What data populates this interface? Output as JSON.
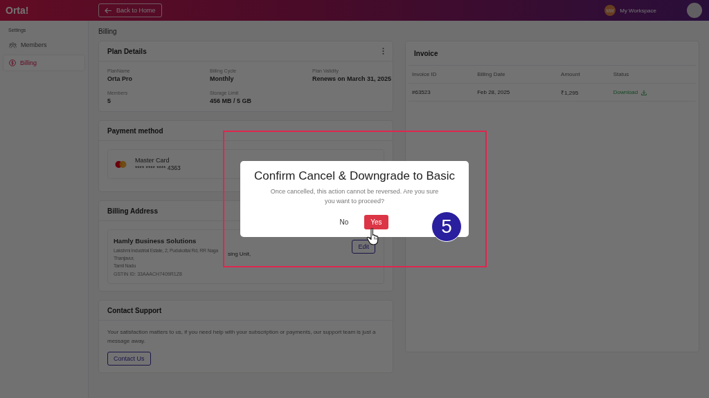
{
  "header": {
    "logo": "Orta!",
    "back_button": "Back to Home",
    "workspace": {
      "initials": "MW",
      "name": "My Workspace"
    }
  },
  "sidebar": {
    "section": "Settings",
    "items": [
      {
        "label": "Members",
        "selected": false
      },
      {
        "label": "Billing",
        "selected": true
      }
    ]
  },
  "page_title": "Billing",
  "plan_details": {
    "title": "Plan Details",
    "fields": [
      {
        "label": "PlanName",
        "value": "Orta Pro"
      },
      {
        "label": "Billing Cycle",
        "value": "Monthly"
      },
      {
        "label": "Plan Validity",
        "value": "Renews on March 31, 2025"
      },
      {
        "label": "Members",
        "value": "5"
      },
      {
        "label": "Storage Limit",
        "value": "456 MB / 5 GB"
      }
    ]
  },
  "payment_method": {
    "title": "Payment method",
    "card_name": "Master Card",
    "card_number": "**** **** **** 4363"
  },
  "billing_address": {
    "title": "Billing Address",
    "company": "Hamly Business Solutions",
    "lines": [
      "Lakshmi Industrial Estate, 2, Pudukottai Rd, RR Naga",
      "Thanjavur,",
      "Tamil Nadu"
    ],
    "gstin": "GSTIN ID: 33AAACH7409R1Z8",
    "fragment": "sing Unit,",
    "edit_button": "Edit"
  },
  "contact_support": {
    "title": "Contact Support",
    "message": "Your satisfaction matters to us, if you need help with your subscription or payments, our support team is just a message away.",
    "button": "Contact Us"
  },
  "invoice": {
    "title": "Invoice",
    "columns": [
      "Invoice ID",
      "Billing Date",
      "Amount",
      "Status"
    ],
    "rows": [
      {
        "cells": [
          "#63523",
          "Feb 28, 2025",
          "₹1,295"
        ],
        "status": "Download"
      }
    ]
  },
  "dialog": {
    "title": "Confirm Cancel & Downgrade to Basic",
    "message": "Once cancelled, this action cannot be reversed. Are you sure you want to proceed?",
    "buttons": [
      {
        "label": "No",
        "kind": "secondary"
      },
      {
        "label": "Yes",
        "kind": "primary"
      }
    ]
  },
  "step_badge": "5"
}
